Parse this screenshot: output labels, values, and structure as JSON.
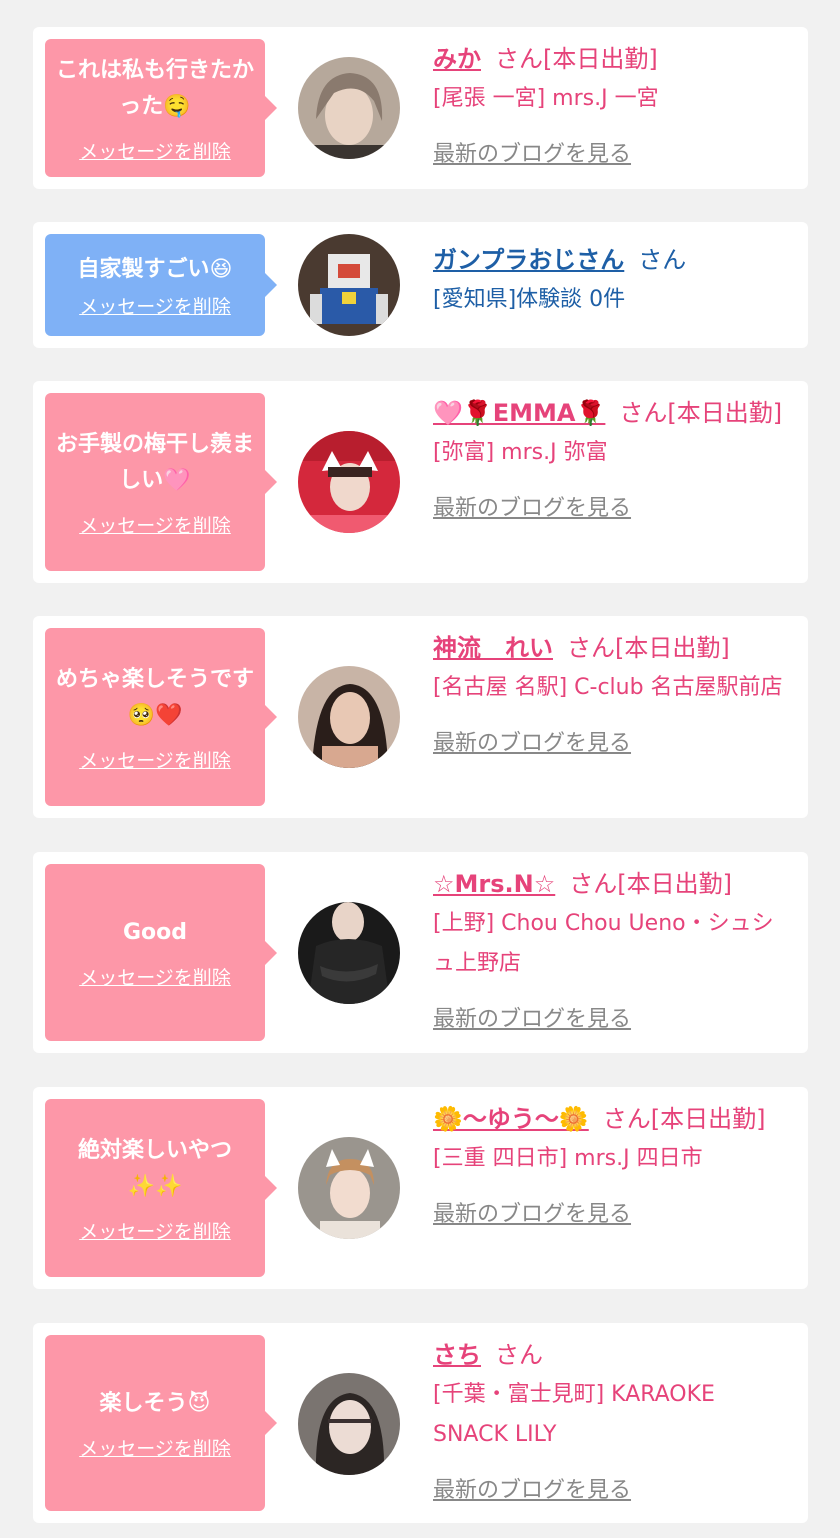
{
  "labels": {
    "delete": "メッセージを削除",
    "blog": "最新のブログを見る"
  },
  "colors": {
    "pink_bubble": "#fd97a8",
    "blue_bubble": "#7fb1f6",
    "pink_text": "#e6437a",
    "blue_text": "#1e5fa6",
    "blog_link": "#888888",
    "page_bg": "#f1f1f1"
  },
  "messages": [
    {
      "message": "これは私も行きたかった🤤",
      "name": "みか",
      "suffix": "さん[本日出勤]",
      "shop": "[尾張 一宮] mrs.J 一宮",
      "theme": "pink"
    },
    {
      "message": "自家製すごい😆",
      "name": "ガンプラおじさん",
      "suffix": "さん",
      "shop": "[愛知県]体験談 0件",
      "theme": "blue"
    },
    {
      "message": "お手製の梅干し羨ましい🩷",
      "name": "🩷🌹EMMA🌹",
      "suffix": "さん[本日出勤]",
      "shop": "[弥富] mrs.J 弥富",
      "theme": "pink"
    },
    {
      "message": "めちゃ楽しそうです🥺❤️",
      "name": "神流　れい",
      "suffix": "さん[本日出勤]",
      "shop": "[名古屋 名駅] C-club 名古屋駅前店",
      "theme": "pink"
    },
    {
      "message": "Good",
      "name": "☆Mrs.N☆",
      "suffix": "さん[本日出勤]",
      "shop": "[上野] Chou Chou Ueno・シュシュ上野店",
      "theme": "pink"
    },
    {
      "message": "絶対楽しいやつ✨✨",
      "name": "🌼〜ゆう〜🌼",
      "suffix": "さん[本日出勤]",
      "shop": "[三重 四日市] mrs.J 四日市",
      "theme": "pink"
    },
    {
      "message": "楽しそう😈",
      "name": "さち",
      "suffix": "さん",
      "shop": "[千葉・富士見町] KARAOKE SNACK LILY",
      "theme": "pink"
    }
  ]
}
